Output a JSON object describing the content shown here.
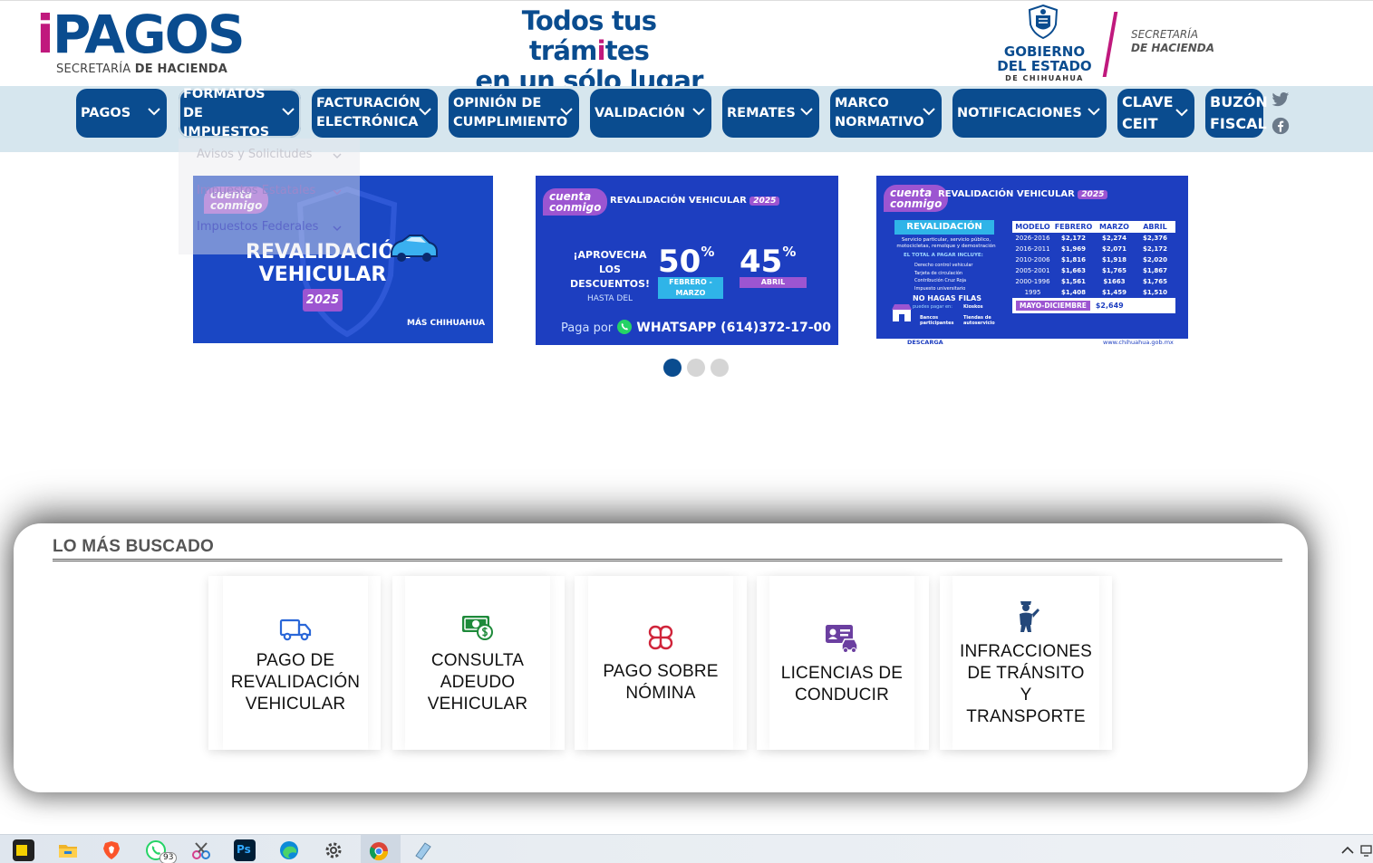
{
  "header": {
    "logo_i": "i",
    "logo_rest": "PAGOS",
    "logo_sub_a": "SECRETARÍA",
    "logo_sub_b": "DE HACIENDA",
    "tagline_line1_a": "Todos tus trám",
    "tagline_line1_accent": "i",
    "tagline_line1_b": "tes",
    "tagline_line2": "en un sólo lugar",
    "gov_line1": "GOBIERNO",
    "gov_line2": "DEL ESTADO",
    "gov_line3": "DE CHIHUAHUA",
    "sec_line1": "SECRETARÍA",
    "sec_line2": "DE HACIENDA"
  },
  "nav": [
    {
      "line1": "PAGOS",
      "line2": ""
    },
    {
      "line1": "FORMATOS DE",
      "line2": "IMPUESTOS"
    },
    {
      "line1": "FACTURACIÓN",
      "line2": "ELECTRÓNICA"
    },
    {
      "line1": "OPINIÓN DE",
      "line2": "CUMPLIMIENTO"
    },
    {
      "line1": "VALIDACIÓN",
      "line2": ""
    },
    {
      "line1": "REMATES",
      "line2": ""
    },
    {
      "line1": "MARCO",
      "line2": "NORMATIVO"
    },
    {
      "line1": "NOTIFICACIONES",
      "line2": ""
    },
    {
      "line1": "CLAVE",
      "line2": "CEIT"
    },
    {
      "line1": "BUZÓN",
      "line2": "FISCAL"
    }
  ],
  "dropdown": [
    "Avisos y Solicitudes",
    "Impuestos Estatales",
    "Impuestos Federales"
  ],
  "banners": {
    "b1": {
      "badge_a": "cuenta",
      "badge_b": "conmigo",
      "title_l1": "REVALIDACIÓN",
      "title_l2": "VEHICULAR",
      "year": "2025",
      "footer": "MÁS CHIHUAHUA"
    },
    "b2": {
      "badge_a": "cuenta",
      "badge_b": "conmigo",
      "title": "REVALIDACIÓN VEHICULAR",
      "year": "2025",
      "promo_l1": "¡APROVECHA LOS",
      "promo_l2": "DESCUENTOS!",
      "promo_l3": "HASTA DEL",
      "pct1": "50",
      "pct2": "45",
      "pct_sign": "%",
      "pill1": "FEBRERO - MARZO",
      "pill2": "ABRIL",
      "wa_a": "Paga por",
      "wa_b": "WHATSAPP (614)372-17-00"
    },
    "b3": {
      "badge_a": "cuenta",
      "badge_b": "conmigo",
      "title": "REVALIDACIÓN VEHICULAR",
      "year": "2025",
      "left_head": "REVALIDACIÓN",
      "left_l1": "Servicio particular, servicio público,",
      "left_l2": "motocicletas, remolque y demostración",
      "left_l3": "EL TOTAL A PAGAR INCLUYE:",
      "items": [
        "Derecho control vehicular",
        "Tarjeta de circulación",
        "Contribución Cruz Roja",
        "Impuesto universitario"
      ],
      "no_filas": "NO HAGAS FILAS",
      "pay_where": "puedes pagar en:",
      "kiosk": "Kioskos",
      "banks": "Bancos participantes",
      "stores": "Tiendas de autoservicio",
      "descarga": "DESCARGA",
      "web": "www.chihuahua.gob.mx",
      "table_head": [
        "MODELO",
        "FEBRERO",
        "MARZO",
        "ABRIL"
      ],
      "table_rows": [
        [
          "2026-2016",
          "$2,172",
          "$2,274",
          "$2,376"
        ],
        [
          "2016-2011",
          "$1,969",
          "$2,071",
          "$2,172"
        ],
        [
          "2010-2006",
          "$1,816",
          "$1,918",
          "$2,020"
        ],
        [
          "2005-2001",
          "$1,663",
          "$1,765",
          "$1,867"
        ],
        [
          "2000-1996",
          "$1,561",
          "$1663",
          "$1,765"
        ],
        [
          "1995",
          "$1,408",
          "$1,459",
          "$1,510"
        ]
      ],
      "mayo": "MAYO-DICIEMBRE",
      "mayo_val": "$2,649"
    }
  },
  "mas_buscado": {
    "title": "LO MÁS BUSCADO",
    "cards": [
      {
        "icon": "truck-icon",
        "lines": [
          "PAGO DE",
          "REVALIDACIÓN",
          "VEHICULAR"
        ],
        "color": "#2a67d8"
      },
      {
        "icon": "money-icon",
        "lines": [
          "CONSULTA",
          "ADEUDO",
          "VEHICULAR"
        ],
        "color": "#1e8a3a"
      },
      {
        "icon": "command-icon",
        "lines": [
          "PAGO SOBRE",
          "NÓMINA"
        ],
        "color": "#d0243a"
      },
      {
        "icon": "license-icon",
        "lines": [
          "LICENCIAS DE",
          "CONDUCIR"
        ],
        "color": "#6b3fa0"
      },
      {
        "icon": "traffic-officer-icon",
        "lines": [
          "INFRACCIONES",
          "DE TRÁNSITO",
          "Y",
          "TRANSPORTE"
        ],
        "color": "#24487a"
      }
    ]
  },
  "taskbar": {
    "whatsapp_badge": "93"
  },
  "colors": {
    "brand_blue": "#0a4c8f",
    "brand_magenta": "#c0197d",
    "nav_bg": "#d6e6ee",
    "banner_blue": "#1d3ec0",
    "badge_purple": "#9c55d1"
  }
}
